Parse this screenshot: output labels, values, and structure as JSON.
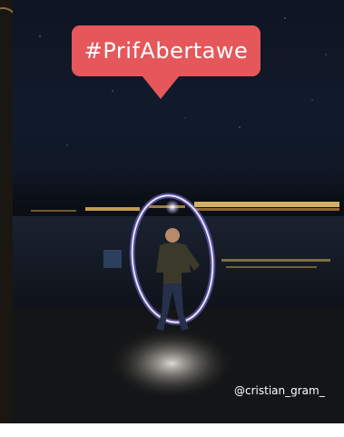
{
  "hashtag": "#PrifAbertawe",
  "photo_credit": "@cristian_gram_",
  "colors": {
    "bubble": "#e5575a",
    "sky": "#101827",
    "light_ring": "#b9a4ff"
  }
}
